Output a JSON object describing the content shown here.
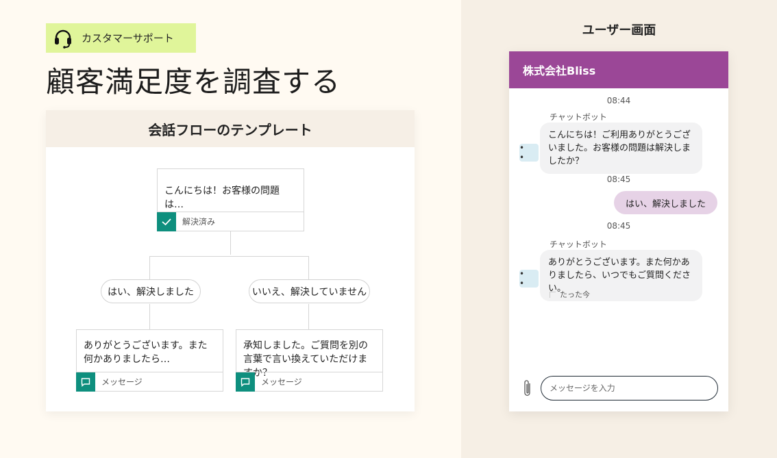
{
  "tag": {
    "label": "カスタマーサポート",
    "icon": "headset-icon"
  },
  "headline": "顧客満足度を調査する",
  "flow": {
    "title": "会話フローのテンプレート",
    "root": {
      "text": "こんにちは！お客様の問題は…",
      "footer": "解決済み",
      "icon": "check-icon"
    },
    "branches": [
      {
        "pill": "はい、解決しました",
        "text": "ありがとうございます。また何かありましたら…",
        "footer": "メッセージ",
        "icon": "chat-icon"
      },
      {
        "pill": "いいえ、解決していません",
        "text": "承知しました。ご質問を別の言葉で言い換えていただけますか？",
        "footer": "メッセージ",
        "icon": "chat-icon"
      }
    ],
    "accent": "#0e8f7e"
  },
  "user_screen": {
    "title": "ユーザー画面",
    "company": "株式会社Bliss",
    "header_color": "#9b4797",
    "messages": {
      "t1": "08:44",
      "sender1": "チャットボット",
      "bot1": "こんにちは！ご利用ありがとうございました。お客様の問題は解決しましたか？",
      "t2": "08:45",
      "user1": "はい、解決しました",
      "t3": "08:45",
      "sender2": "チャットボット",
      "bot2": "ありがとうございます。また何かありましたら、いつでもご質問ください。",
      "status": "たった今"
    },
    "avatar_text": "• •",
    "input_placeholder": "メッセージを入力"
  }
}
